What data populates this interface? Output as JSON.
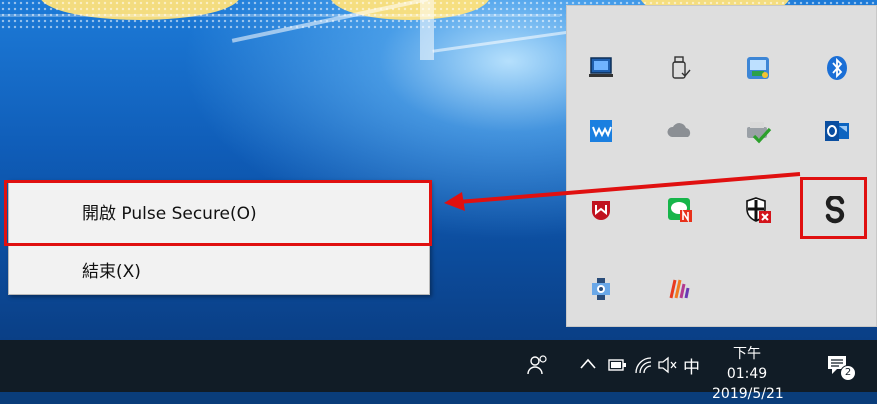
{
  "context_menu": {
    "open_label": "開啟 Pulse Secure(O)",
    "exit_label": "結束(X)"
  },
  "tray_icons": [
    {
      "name": "laptop-icon"
    },
    {
      "name": "usb-drive-icon"
    },
    {
      "name": "network-display-icon"
    },
    {
      "name": "bluetooth-icon"
    },
    {
      "name": "wacom-icon"
    },
    {
      "name": "onedrive-icon"
    },
    {
      "name": "printer-check-icon"
    },
    {
      "name": "outlook-icon"
    },
    {
      "name": "mcafee-icon"
    },
    {
      "name": "line-chat-icon"
    },
    {
      "name": "security-shield-icon"
    },
    {
      "name": "pulse-secure-icon"
    },
    {
      "name": "settings-gear-icon"
    },
    {
      "name": "app-stripes-icon"
    }
  ],
  "taskbar": {
    "time": "下午 01:49",
    "date": "2019/5/21",
    "ime_label": "中",
    "notification_count": "2"
  },
  "colors": {
    "highlight": "#e01010",
    "tray_panel": "#dedede",
    "taskbar": "#111c26"
  }
}
